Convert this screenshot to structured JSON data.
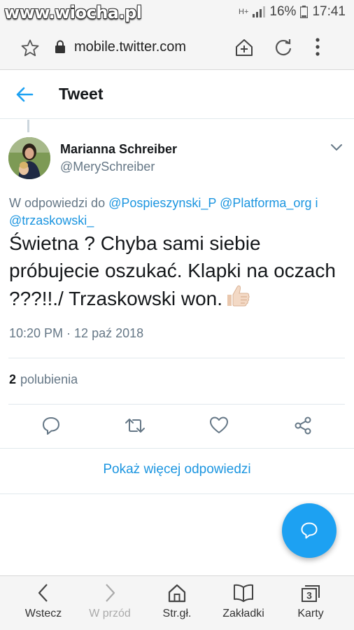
{
  "status_bar": {
    "watermark": "www.wiocha.pl",
    "network": "H+",
    "battery": "16%",
    "time": "17:41"
  },
  "browser": {
    "url": "mobile.twitter.com"
  },
  "header": {
    "title": "Tweet"
  },
  "tweet": {
    "author_name": "Marianna Schreiber",
    "author_handle": "@MerySchreiber",
    "reply_prefix": "W odpowiedzi do",
    "reply_mentions": [
      "@Pospieszynski_P",
      "@Platforma_org"
    ],
    "reply_conjunction": "i",
    "reply_last_mention": "@trzaskowski_",
    "text": "Świetna ? Chyba sami siebie próbujecie oszukać. Klapki na oczach ???!!./ Trzaskowski won.",
    "emoji": "thumbs-up-icon",
    "timestamp": "10:20 PM · 12 paź 2018",
    "likes_count": "2",
    "likes_label": "polubienia"
  },
  "actions": {
    "icons": [
      "reply-icon",
      "retweet-icon",
      "like-icon",
      "share-icon"
    ]
  },
  "more_replies_label": "Pokaż więcej odpowiedzi",
  "bottom_nav": {
    "back": "Wstecz",
    "forward": "W przód",
    "home": "Str.gł.",
    "bookmarks": "Zakładki",
    "tabs": "Karty",
    "tabs_count": "3"
  },
  "colors": {
    "accent": "#1da1f2",
    "link": "#1b95e0",
    "secondary_text": "#657786"
  }
}
